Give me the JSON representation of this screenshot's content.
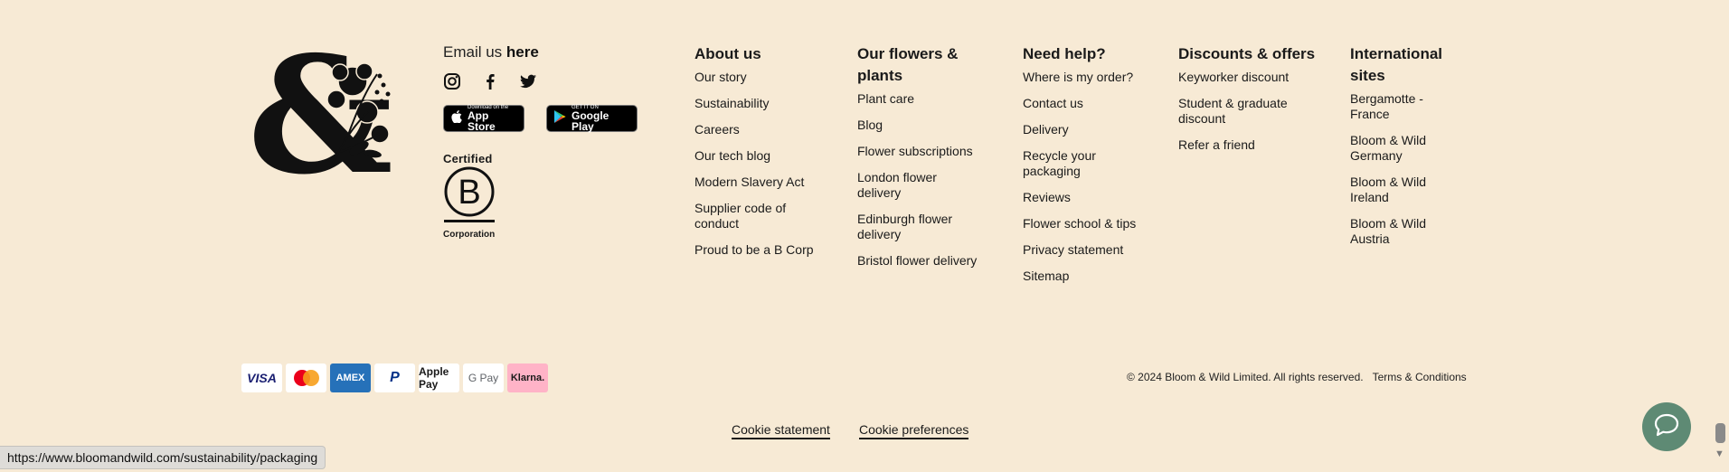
{
  "contact": {
    "email_prefix": "Email us",
    "email_link": "here"
  },
  "social": [
    "instagram-icon",
    "facebook-icon",
    "twitter-icon"
  ],
  "stores": {
    "apple_small": "Download on the",
    "apple_big": "App Store",
    "google_small": "GET IT ON",
    "google_big": "Google Play"
  },
  "bcorp": {
    "certified": "Certified",
    "corporation": "Corporation"
  },
  "columns": [
    {
      "title": "About us",
      "items": [
        "Our story",
        "Sustainability",
        "Careers",
        "Our tech blog",
        "Modern Slavery Act",
        "Supplier code of conduct",
        "Proud to be a B Corp"
      ]
    },
    {
      "title": "Our flowers & plants",
      "items": [
        "Plant care",
        "Blog",
        "Flower subscriptions",
        "London flower delivery",
        "Edinburgh flower delivery",
        "Bristol flower delivery"
      ]
    },
    {
      "title": "Need help?",
      "items": [
        "Where is my order?",
        "Contact us",
        "Delivery",
        "Recycle your packaging",
        "Reviews",
        "Flower school & tips",
        "Privacy statement",
        "Sitemap"
      ]
    },
    {
      "title": "Discounts & offers",
      "items": [
        "Keyworker discount",
        "Student & graduate discount",
        "Refer a friend"
      ]
    },
    {
      "title": "International sites",
      "items": [
        "Bergamotte - France",
        "Bloom & Wild Germany",
        "Bloom & Wild Ireland",
        "Bloom & Wild Austria"
      ]
    }
  ],
  "payments": [
    "VISA",
    "mastercard",
    "AMEX",
    "PayPal",
    "Apple Pay",
    "G Pay",
    "Klarna."
  ],
  "footer": {
    "copyright": "© 2024 Bloom & Wild Limited. All rights reserved.",
    "terms": "Terms & Conditions",
    "cookie_statement": "Cookie statement",
    "cookie_preferences": "Cookie preferences"
  },
  "status_url": "https://www.bloomandwild.com/sustainability/packaging",
  "colors": {
    "background": "#f7ead5",
    "chat_button": "#5e8a74",
    "amex": "#2671b9",
    "klarna": "#ffb3c7"
  }
}
